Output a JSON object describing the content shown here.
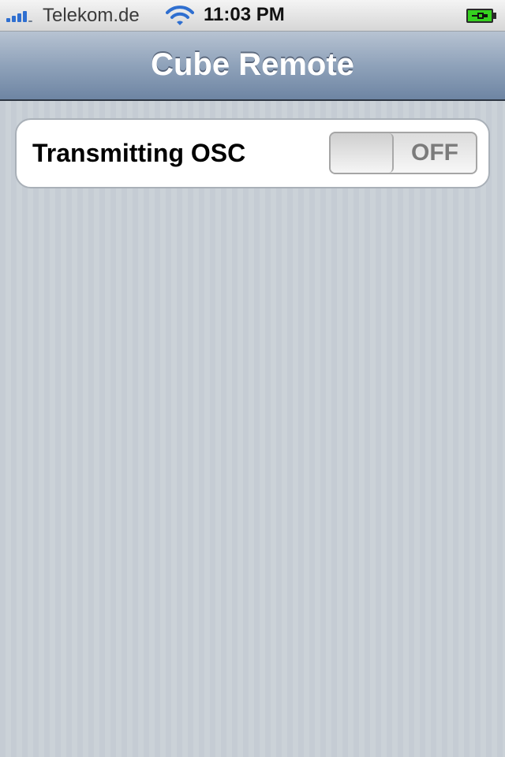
{
  "status_bar": {
    "carrier": "Telekom.de",
    "time": "11:03 PM",
    "signal_icon": "signal-bars-icon",
    "wifi_icon": "wifi-icon",
    "battery_icon": "battery-charging-icon"
  },
  "nav_bar": {
    "title": "Cube Remote"
  },
  "settings": {
    "rows": [
      {
        "label": "Transmitting OSC",
        "switch_state": "OFF"
      }
    ]
  },
  "colors": {
    "accent_blue": "#2f6fd0",
    "nav_bar": "#8fa2ba",
    "background": "#c5ccd4",
    "battery_green": "#35d11f"
  }
}
